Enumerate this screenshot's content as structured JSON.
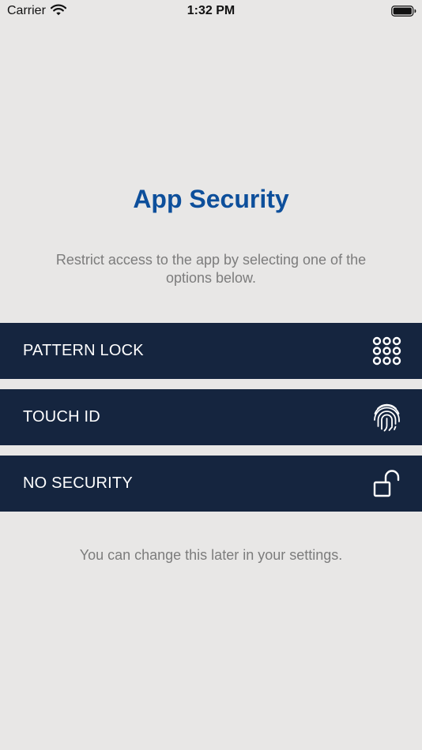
{
  "status_bar": {
    "carrier": "Carrier",
    "time": "1:32 PM"
  },
  "title": "App Security",
  "subtitle": "Restrict access to the app by selecting one of the options below.",
  "options": [
    {
      "label": "PATTERN LOCK",
      "icon": "pattern-grid-icon"
    },
    {
      "label": "TOUCH ID",
      "icon": "fingerprint-icon"
    },
    {
      "label": "NO SECURITY",
      "icon": "unlocked-padlock-icon"
    }
  ],
  "footnote": "You can change this later in your settings.",
  "colors": {
    "background": "#e8e7e6",
    "title": "#0d4f9b",
    "option_background": "#15253f",
    "option_text": "#ffffff",
    "muted_text": "#7c7c7c"
  }
}
